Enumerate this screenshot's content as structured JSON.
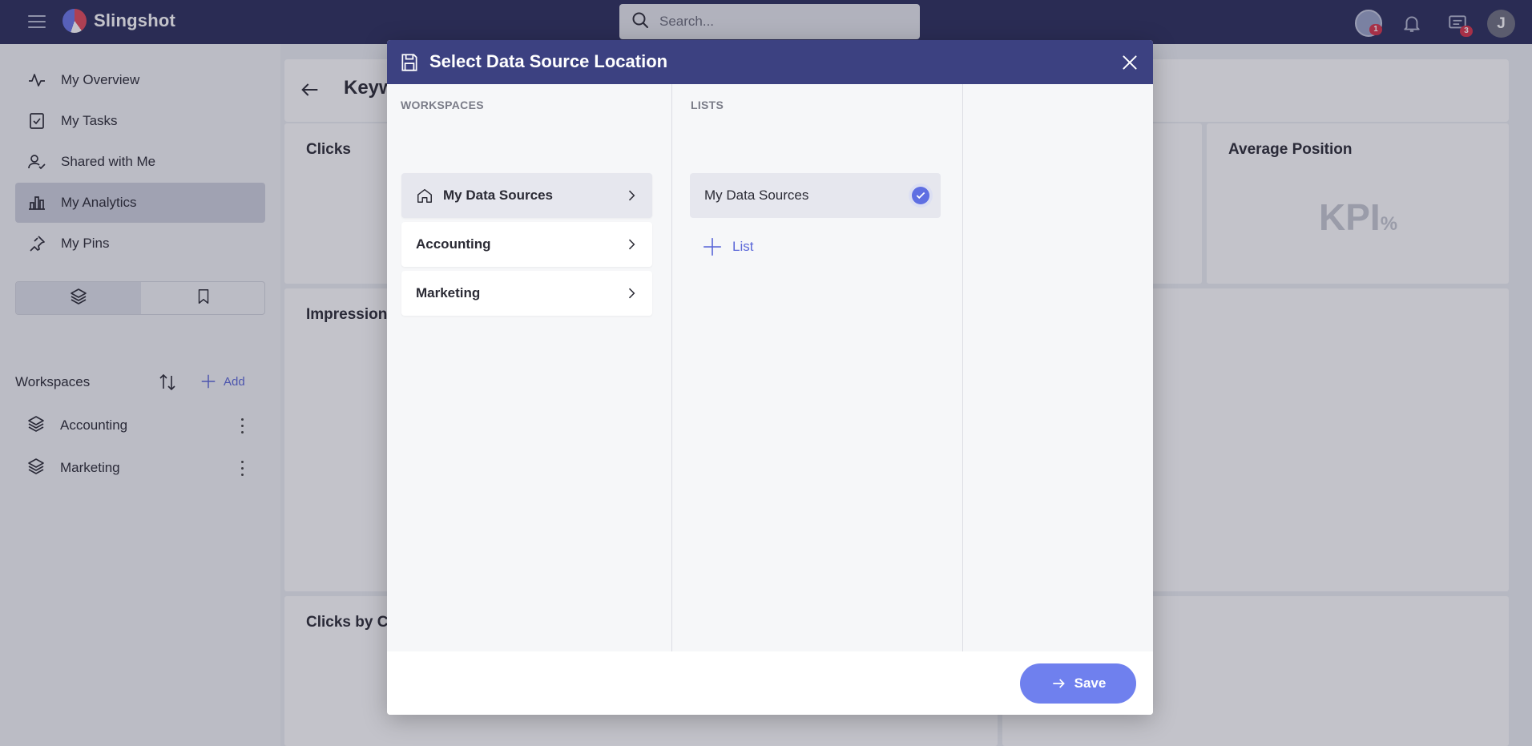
{
  "app": {
    "name": "Slingshot"
  },
  "search": {
    "placeholder": "Search..."
  },
  "header": {
    "notifications_badge": "1",
    "messages_badge": "3",
    "avatar_initial": "J"
  },
  "sidebar": {
    "items": [
      {
        "label": "My Overview",
        "icon": "pulse-icon"
      },
      {
        "label": "My Tasks",
        "icon": "task-check-icon"
      },
      {
        "label": "Shared with Me",
        "icon": "user-check-icon"
      },
      {
        "label": "My Analytics",
        "icon": "bar-chart-icon",
        "active": true
      },
      {
        "label": "My Pins",
        "icon": "pin-icon"
      }
    ],
    "workspaces_title": "Workspaces",
    "add_label": "Add",
    "workspaces": [
      {
        "label": "Accounting"
      },
      {
        "label": "Marketing"
      }
    ]
  },
  "dashboard": {
    "title": "Keyw",
    "cards": {
      "clicks": "Clicks",
      "average_position": "Average Position",
      "kpi_text": "KPI",
      "kpi_unit": "%",
      "impressions": "Impression",
      "clicks_by": "Clicks by C"
    }
  },
  "modal": {
    "title": "Select Data Source Location",
    "workspaces_label": "WORKSPACES",
    "lists_label": "LISTS",
    "workspaces": [
      {
        "label": "My Data Sources",
        "selected": true
      },
      {
        "label": "Accounting"
      },
      {
        "label": "Marketing"
      }
    ],
    "lists": [
      {
        "label": "My Data Sources",
        "checked": true
      }
    ],
    "add_list_label": "List",
    "save_label": "Save"
  },
  "colors": {
    "accent": "#5a67d8",
    "header_bg": "#2b2f5c",
    "modal_header_bg": "#3c4181",
    "badge": "#d8344a"
  }
}
